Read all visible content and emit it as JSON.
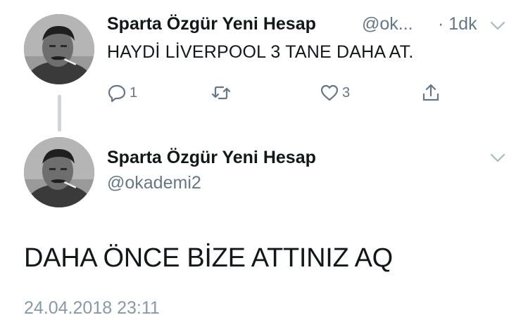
{
  "tweet1": {
    "display_name": "Sparta Özgür Yeni Hesap",
    "handle": "@ok...",
    "time": "· 1dk",
    "text": "HAYDİ LİVERPOOL 3 TANE DAHA AT.",
    "actions": {
      "reply_count": "1",
      "like_count": "3"
    }
  },
  "tweet2": {
    "display_name": "Sparta Özgür Yeni Hesap",
    "handle": "@okademi2",
    "text": "DAHA ÖNCE BİZE ATTINIZ AQ",
    "date": "24.04.2018 23:11"
  },
  "icons": {
    "reply": "reply-icon",
    "retweet": "retweet-icon",
    "like": "heart-icon",
    "share": "share-icon",
    "menu": "chevron-down-icon"
  },
  "colors": {
    "text": "#14171a",
    "secondary": "#657786",
    "date": "#8899a6",
    "thread_line": "#cfd5d9"
  }
}
